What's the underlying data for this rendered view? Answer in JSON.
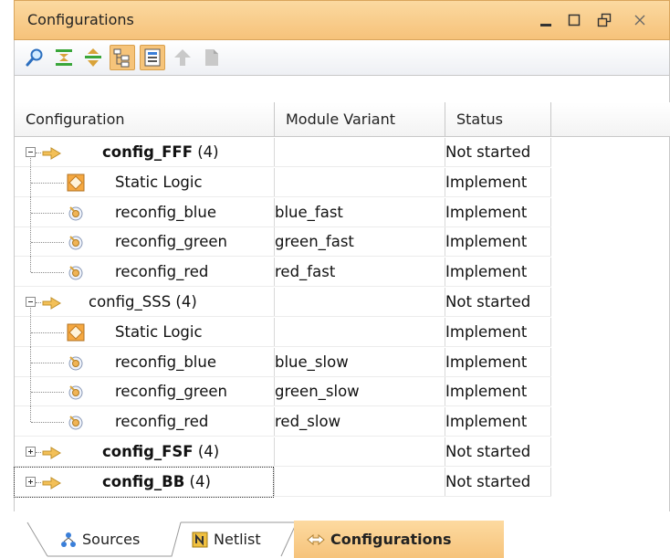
{
  "panel": {
    "title": "Configurations",
    "controls": {
      "minimize": "minimize-icon",
      "maximize": "maximize-icon",
      "restore": "restore-icon",
      "close": "close-icon"
    }
  },
  "toolbar": {
    "icons": [
      "search-icon",
      "collapse-all-icon",
      "expand-all-icon",
      "show-hierarchy-icon",
      "group-by-icon",
      "promote-icon",
      "reference-icon"
    ],
    "pressed_colors": "#f6c47a"
  },
  "table": {
    "columns": [
      "Configuration",
      "Module Variant",
      "Status"
    ],
    "rows": [
      {
        "level": 0,
        "expanded": true,
        "name": "config_FFF",
        "count": "(4)",
        "variant": "",
        "status": "Not started",
        "bold": true
      },
      {
        "level": 1,
        "icon": "static-logic-icon",
        "name": "Static Logic",
        "variant": "",
        "status": "Implement"
      },
      {
        "level": 1,
        "icon": "partition-icon",
        "name": "reconfig_blue",
        "variant": "blue_fast",
        "status": "Implement"
      },
      {
        "level": 1,
        "icon": "partition-icon",
        "name": "reconfig_green",
        "variant": "green_fast",
        "status": "Implement"
      },
      {
        "level": 1,
        "icon": "partition-icon",
        "name": "reconfig_red",
        "variant": "red_fast",
        "status": "Implement",
        "last": true
      },
      {
        "level": 0,
        "expanded": true,
        "name": "config_SSS",
        "count": "(4)",
        "variant": "",
        "status": "Not started",
        "bold": false
      },
      {
        "level": 1,
        "icon": "static-logic-icon",
        "name": "Static Logic",
        "variant": "",
        "status": "Implement"
      },
      {
        "level": 1,
        "icon": "partition-icon",
        "name": "reconfig_blue",
        "variant": "blue_slow",
        "status": "Implement"
      },
      {
        "level": 1,
        "icon": "partition-icon",
        "name": "reconfig_green",
        "variant": "green_slow",
        "status": "Implement"
      },
      {
        "level": 1,
        "icon": "partition-icon",
        "name": "reconfig_red",
        "variant": "red_slow",
        "status": "Implement",
        "last": true
      },
      {
        "level": 0,
        "expanded": false,
        "name": "config_FSF",
        "count": "(4)",
        "variant": "",
        "status": "Not started",
        "bold": true
      },
      {
        "level": 0,
        "expanded": false,
        "name": "config_BB",
        "count": "(4)",
        "variant": "",
        "status": "Not started",
        "bold": true,
        "focused": true
      }
    ]
  },
  "tabs": [
    {
      "label": "Sources",
      "icon": "sources-icon"
    },
    {
      "label": "Netlist",
      "icon": "netlist-icon"
    },
    {
      "label": "Configurations",
      "icon": "configurations-icon",
      "active": true
    }
  ]
}
